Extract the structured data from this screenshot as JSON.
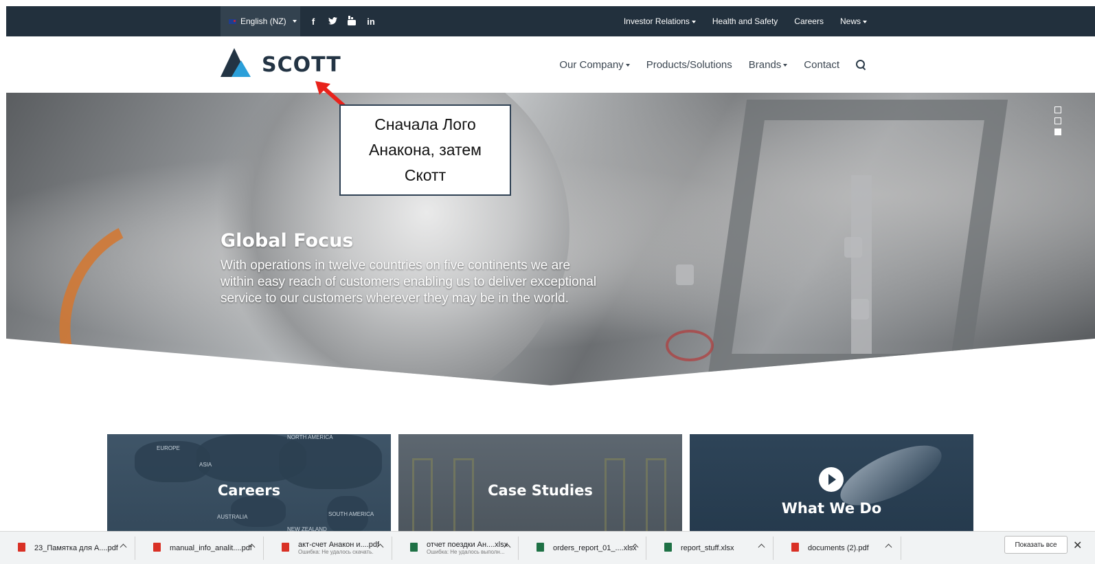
{
  "topbar": {
    "language": "English (NZ)",
    "social": [
      {
        "icon": "facebook-icon",
        "glyph": "f"
      },
      {
        "icon": "twitter-icon",
        "glyph": "t"
      },
      {
        "icon": "youtube-icon",
        "glyph": "▣"
      },
      {
        "icon": "linkedin-icon",
        "glyph": "in"
      }
    ],
    "links": [
      "Investor Relations",
      "Health and Safety",
      "Careers",
      "News"
    ]
  },
  "header": {
    "logo_text": "SCOTT",
    "nav": [
      "Our Company",
      "Products/Solutions",
      "Brands",
      "Contact"
    ]
  },
  "hero": {
    "title": "Global Focus",
    "text": "With operations in twelve countries on five continents we are within easy reach of customers enabling us to deliver exceptional service to our customers wherever they may be in the world.",
    "slides_total": 3,
    "active_slide": 3
  },
  "annotation": {
    "text": "Сначала Лого Анакона, затем Скотт"
  },
  "cards": {
    "careers": {
      "title": "Careers",
      "map_labels": [
        "EUROPE",
        "ASIA",
        "NORTH AMERICA",
        "AUSTRALIA",
        "SOUTH AMERICA",
        "NEW ZEALAND"
      ]
    },
    "case_studies": {
      "title": "Case Studies"
    },
    "what_we_do": {
      "title": "What We Do"
    }
  },
  "downloads": {
    "items": [
      {
        "name": "23_Памятка для А....pdf",
        "type": "pdf",
        "sub": ""
      },
      {
        "name": "manual_info_analit....pdf",
        "type": "pdf",
        "sub": ""
      },
      {
        "name": "акт-счет Анакон и....pdf",
        "type": "pdf",
        "sub": "Ошибка: Не удалось скачать."
      },
      {
        "name": "отчет поездки Ан....xlsx",
        "type": "xls",
        "sub": "Ошибка: Не удалось выполн..."
      },
      {
        "name": "orders_report_01_....xlsx",
        "type": "xls",
        "sub": ""
      },
      {
        "name": "report_stuff.xlsx",
        "type": "xls",
        "sub": ""
      },
      {
        "name": "documents (2).pdf",
        "type": "pdf",
        "sub": ""
      }
    ],
    "show_all": "Показать все",
    "close": "✕"
  },
  "colors": {
    "topbar_bg": "#22303d",
    "logo_dark": "#233444",
    "logo_blue": "#2b9fd9",
    "arrow_red": "#e8221b"
  }
}
